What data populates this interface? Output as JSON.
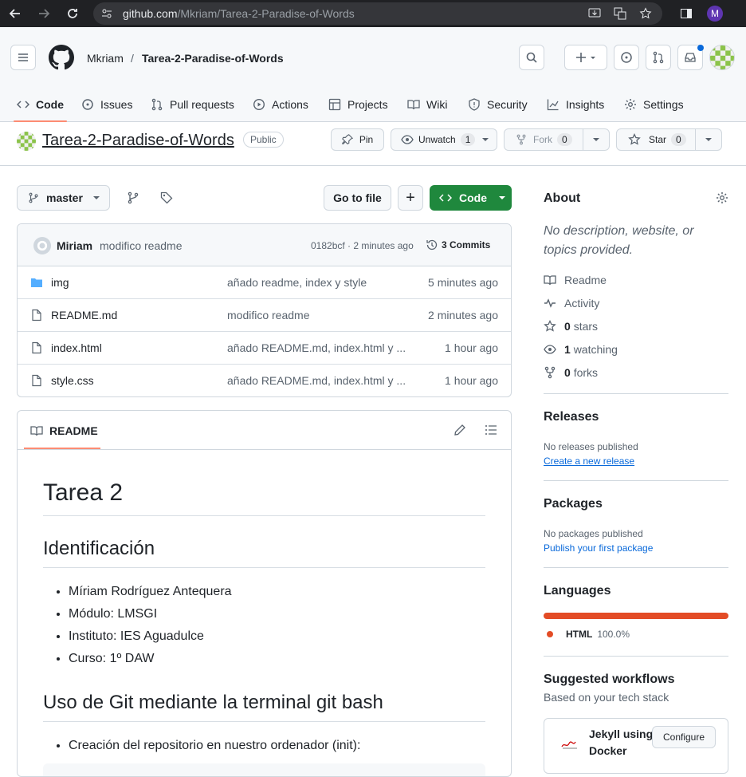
{
  "browser": {
    "url_host": "github.com",
    "url_path": "/Mkriam/Tarea-2-Paradise-of-Words",
    "profile_initial": "M"
  },
  "header": {
    "owner": "Mkriam",
    "separator": "/",
    "repo": "Tarea-2-Paradise-of-Words"
  },
  "tabs": [
    {
      "label": "Code",
      "icon": "code-icon"
    },
    {
      "label": "Issues",
      "icon": "issue-icon"
    },
    {
      "label": "Pull requests",
      "icon": "pull-request-icon"
    },
    {
      "label": "Actions",
      "icon": "play-icon"
    },
    {
      "label": "Projects",
      "icon": "table-icon"
    },
    {
      "label": "Wiki",
      "icon": "book-icon"
    },
    {
      "label": "Security",
      "icon": "shield-icon"
    },
    {
      "label": "Insights",
      "icon": "graph-icon"
    },
    {
      "label": "Settings",
      "icon": "gear-icon"
    }
  ],
  "repo_head": {
    "name": "Tarea-2-Paradise-of-Words",
    "visibility": "Public",
    "pin": "Pin",
    "unwatch": "Unwatch",
    "watch_count": "1",
    "fork": "Fork",
    "fork_count": "0",
    "star": "Star",
    "star_count": "0"
  },
  "toolbar": {
    "branch": "master",
    "go_to_file": "Go to file",
    "add": "+",
    "code": "Code"
  },
  "commit": {
    "author": "Miriam",
    "message": "modifico readme",
    "meta": "0182bcf · 2 minutes ago",
    "commits": "3 Commits"
  },
  "files": [
    {
      "name": "img",
      "type": "folder",
      "message": "añado readme, index y style",
      "time": "5 minutes ago"
    },
    {
      "name": "README.md",
      "type": "file",
      "message": "modifico readme",
      "time": "2 minutes ago"
    },
    {
      "name": "index.html",
      "type": "file",
      "message": "añado README.md, index.html y ...",
      "time": "1 hour ago"
    },
    {
      "name": "style.css",
      "type": "file",
      "message": "añado README.md, index.html y ...",
      "time": "1 hour ago"
    }
  ],
  "readme": {
    "tab": "README",
    "h1": "Tarea 2",
    "h2a": "Identificación",
    "list1": [
      "Míriam Rodríguez Antequera",
      "Módulo: LMSGI",
      "Instituto: IES Aguadulce",
      "Curso: 1º DAW"
    ],
    "h2b": "Uso de Git mediante la terminal git bash",
    "list2": [
      "Creación del repositorio en nuestro ordenador (init):"
    ]
  },
  "about": {
    "title": "About",
    "description": "No description, website, or topics provided.",
    "readme": "Readme",
    "activity": "Activity",
    "stars_n": "0",
    "stars": "stars",
    "watching_n": "1",
    "watching": "watching",
    "forks_n": "0",
    "forks": "forks"
  },
  "releases": {
    "title": "Releases",
    "none": "No releases published",
    "link": "Create a new release"
  },
  "packages": {
    "title": "Packages",
    "none": "No packages published",
    "link": "Publish your first package"
  },
  "languages": {
    "title": "Languages",
    "name": "HTML",
    "percent": "100.0%",
    "color": "#e34c26",
    "fraction": 1.0
  },
  "workflows": {
    "title": "Suggested workflows",
    "subtitle": "Based on your tech stack",
    "name1": "Jekyll using",
    "name2": "Docker",
    "configure": "Configure"
  }
}
